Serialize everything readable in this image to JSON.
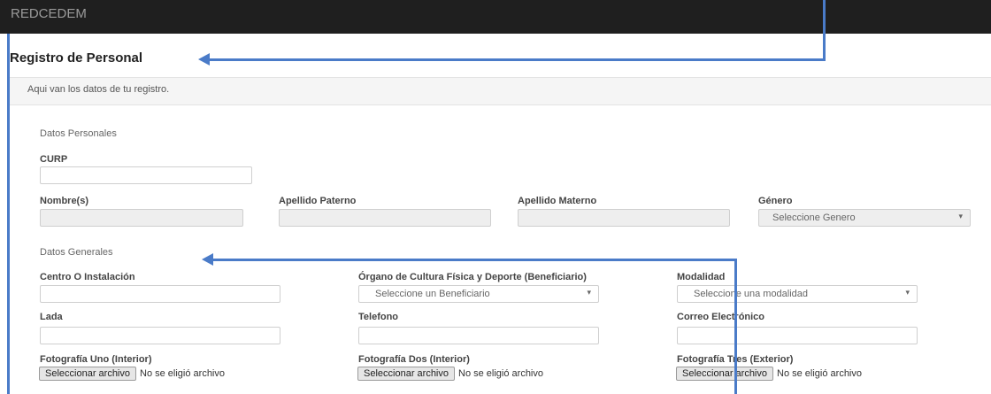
{
  "brand": "REDCEDEM",
  "page_title": "Registro de Personal",
  "panel_text": "Aqui van los datos de tu registro.",
  "sections": {
    "personal": "Datos Personales",
    "general": "Datos Generales"
  },
  "labels": {
    "curp": "CURP",
    "nombre": "Nombre(s)",
    "apellido_paterno": "Apellido Paterno",
    "apellido_materno": "Apellido Materno",
    "genero": "Género",
    "centro": "Centro O Instalación",
    "organo": "Órgano de Cultura Física y Deporte (Beneficiario)",
    "modalidad": "Modalidad",
    "lada": "Lada",
    "telefono": "Telefono",
    "correo": "Correo Electrónico",
    "foto1": "Fotografía Uno (Interior)",
    "foto2": "Fotografía Dos (Interior)",
    "foto3": "Fotografía Tres (Exterior)"
  },
  "selects": {
    "genero": "Seleccione Genero",
    "beneficiario": "Seleccione un Beneficiario",
    "modalidad": "Seleccione una modalidad"
  },
  "file": {
    "button": "Seleccionar archivo",
    "status": "No se eligió archivo"
  },
  "icons": {
    "select_caret": "▾"
  },
  "colors": {
    "topbar": "#1f1f1f",
    "annotation": "#4a7bc8"
  }
}
